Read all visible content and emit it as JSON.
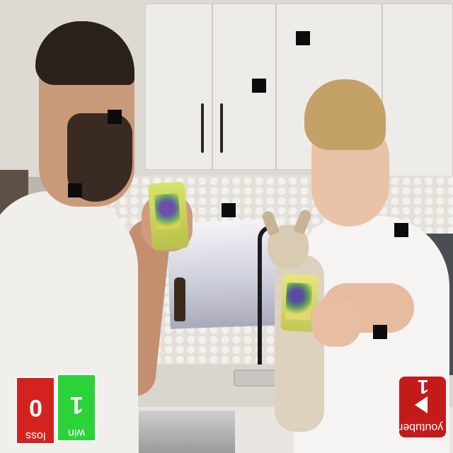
{
  "image": {
    "description_alt": "",
    "scoreboard": {
      "loss": {
        "value": "0",
        "label": "loss",
        "color": "#d4231f"
      },
      "win": {
        "value": "1",
        "label": "win",
        "color": "#2bd33a"
      }
    },
    "badge": {
      "count": "1",
      "label": "youtubers",
      "icon": "play-icon",
      "color": "#c41a1a"
    }
  }
}
